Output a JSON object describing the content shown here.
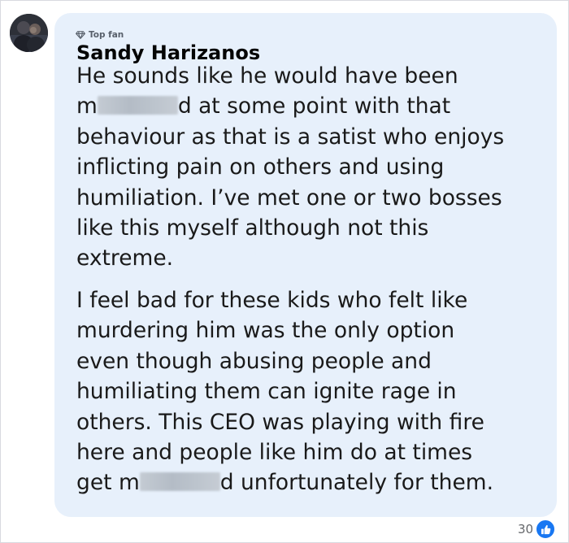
{
  "comment": {
    "badge": "Top fan",
    "author": "Sandy Harizanos",
    "paragraph1": {
      "line1": "He sounds like he would have been",
      "line2_start": "m",
      "line2_end": "d at some point with that",
      "line3": "behaviour as that is a satist who enjoys",
      "line4": "inflicting pain on others and using",
      "line5": "humiliation. I’ve met one or two bosses",
      "line6": "like this myself although not this",
      "line7": "extreme."
    },
    "paragraph2": {
      "line1": "I feel bad for these kids who felt like",
      "line2": "murdering him was the only option",
      "line3": "even though abusing people and",
      "line4": "humiliating them can ignite rage in",
      "line5": "others. This CEO was playing with fire",
      "line6": "here and people like him do at times",
      "line7_start": "get m",
      "line7_end": "d unfortunately for them."
    },
    "reaction_count": "30",
    "reaction_icon": "thumbs-up-icon",
    "colors": {
      "bubble": "#e7f0fb",
      "like_blue": "#1877f2",
      "meta_gray": "#65676b"
    }
  }
}
